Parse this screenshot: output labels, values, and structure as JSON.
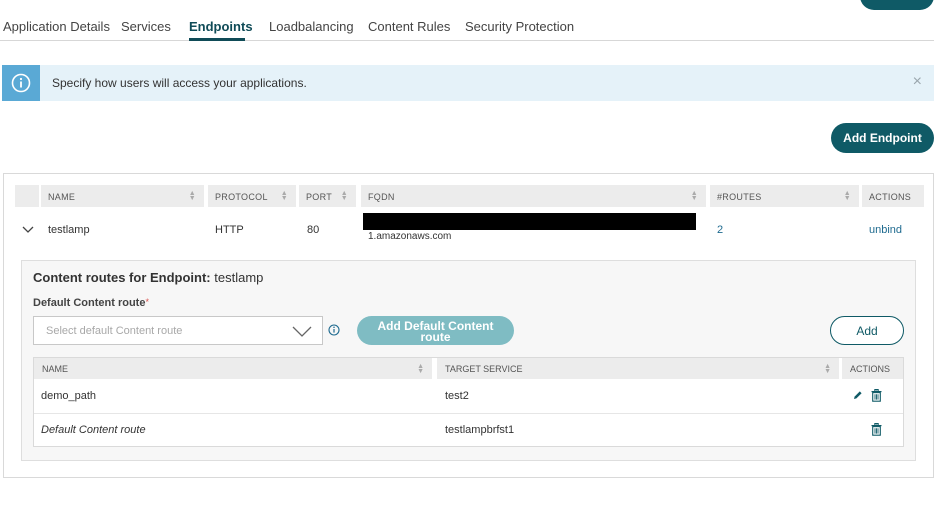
{
  "tabs": [
    {
      "label": "Application Details",
      "active": false
    },
    {
      "label": "Services",
      "active": false
    },
    {
      "label": "Endpoints",
      "active": true
    },
    {
      "label": "Loadbalancing",
      "active": false
    },
    {
      "label": "Content Rules",
      "active": false
    },
    {
      "label": "Security Protection",
      "active": false
    }
  ],
  "banner": {
    "text": "Specify how users will access your applications.",
    "close": "×"
  },
  "add_endpoint_label": "Add Endpoint",
  "endpoints_table": {
    "headers": [
      "NAME",
      "PROTOCOL",
      "PORT",
      "FQDN",
      "#ROUTES",
      "ACTIONS"
    ],
    "rows": [
      {
        "name": "testlamp",
        "protocol": "HTTP",
        "port": "80",
        "fqdn": "1.amazonaws.com",
        "routes": "2",
        "action": "unbind"
      }
    ]
  },
  "content_routes": {
    "title_prefix": "Content routes for Endpoint:",
    "endpoint_name": "testlamp",
    "default_label": "Default Content route",
    "required_mark": "*",
    "select_placeholder": "Select default Content route",
    "add_default_label": "Add Default Content route",
    "add_label": "Add",
    "headers": [
      "NAME",
      "TARGET SERVICE",
      "ACTIONS"
    ],
    "rows": [
      {
        "name": "demo_path",
        "target": "test2",
        "editable": true
      },
      {
        "name": "Default Content route",
        "target": "testlampbrfst1",
        "editable": false
      }
    ]
  },
  "colors": {
    "accent": "#0f5a66",
    "banner_bg": "#e5f2f9",
    "banner_icon_bg": "#5aa9d5",
    "link": "#1e6a8f",
    "required": "#d9534f",
    "disabled_button": "#7fbcc3"
  }
}
